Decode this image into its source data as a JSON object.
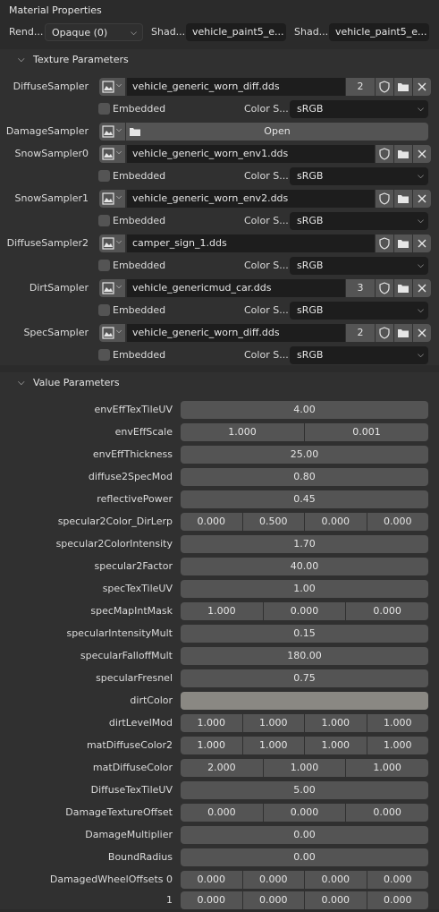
{
  "header": {
    "title": "Material Properties",
    "render_label": "Rend...",
    "render_value": "Opaque (0)",
    "shader1_label": "Shad...",
    "shader1_value": "vehicle_paint5_e...",
    "shader2_label": "Shad...",
    "shader2_value": "vehicle_paint5_e..."
  },
  "texture_panel": {
    "title": "Texture Parameters",
    "embedded_label": "Embedded",
    "colorspace_label": "Color S...",
    "open_label": "Open",
    "samplers": [
      {
        "label": "DiffuseSampler",
        "file": "vehicle_generic_worn_diff.dds",
        "users": "2",
        "colorspace": "sRGB"
      },
      {
        "label": "DamageSampler",
        "open": true
      },
      {
        "label": "SnowSampler0",
        "file": "vehicle_generic_worn_env1.dds",
        "users": "",
        "colorspace": "sRGB"
      },
      {
        "label": "SnowSampler1",
        "file": "vehicle_generic_worn_env2.dds",
        "users": "",
        "colorspace": "sRGB"
      },
      {
        "label": "DiffuseSampler2",
        "file": "camper_sign_1.dds",
        "users": "",
        "colorspace": "sRGB"
      },
      {
        "label": "DirtSampler",
        "file": "vehicle_genericmud_car.dds",
        "users": "3",
        "colorspace": "sRGB"
      },
      {
        "label": "SpecSampler",
        "file": "vehicle_generic_worn_diff.dds",
        "users": "2",
        "colorspace": "sRGB"
      }
    ]
  },
  "value_panel": {
    "title": "Value Parameters",
    "params": [
      {
        "label": "envEffTexTileUV",
        "values": [
          "4.00"
        ]
      },
      {
        "label": "envEffScale",
        "values": [
          "1.000",
          "0.001"
        ]
      },
      {
        "label": "envEffThickness",
        "values": [
          "25.00"
        ]
      },
      {
        "label": "diffuse2SpecMod",
        "values": [
          "0.80"
        ]
      },
      {
        "label": "reflectivePower",
        "values": [
          "0.45"
        ]
      },
      {
        "label": "specular2Color_DirLerp",
        "values": [
          "0.000",
          "0.500",
          "0.000",
          "0.000"
        ]
      },
      {
        "label": "specular2ColorIntensity",
        "values": [
          "1.70"
        ]
      },
      {
        "label": "specular2Factor",
        "values": [
          "40.00"
        ]
      },
      {
        "label": "specTexTileUV",
        "values": [
          "1.00"
        ]
      },
      {
        "label": "specMapIntMask",
        "values": [
          "1.000",
          "0.000",
          "0.000"
        ]
      },
      {
        "label": "specularIntensityMult",
        "values": [
          "0.15"
        ]
      },
      {
        "label": "specularFalloffMult",
        "values": [
          "180.00"
        ]
      },
      {
        "label": "specularFresnel",
        "values": [
          "0.75"
        ]
      },
      {
        "label": "dirtColor",
        "color": "#8a8883"
      },
      {
        "label": "dirtLevelMod",
        "values": [
          "1.000",
          "1.000",
          "1.000",
          "1.000"
        ]
      },
      {
        "label": "matDiffuseColor2",
        "values": [
          "1.000",
          "1.000",
          "1.000",
          "1.000"
        ]
      },
      {
        "label": "matDiffuseColor",
        "values": [
          "2.000",
          "1.000",
          "1.000"
        ]
      },
      {
        "label": "DiffuseTexTileUV",
        "values": [
          "5.00"
        ]
      },
      {
        "label": "DamageTextureOffset",
        "values": [
          "0.000",
          "0.000",
          "0.000"
        ]
      },
      {
        "label": "DamageMultiplier",
        "values": [
          "0.00"
        ]
      },
      {
        "label": "BoundRadius",
        "values": [
          "0.00"
        ]
      },
      {
        "label": "DamagedWheelOffsets 0",
        "values": [
          "0.000",
          "0.000",
          "0.000",
          "0.000"
        ]
      },
      {
        "label": "1",
        "values": [
          "0.000",
          "0.000",
          "0.000",
          "0.000"
        ]
      }
    ]
  }
}
